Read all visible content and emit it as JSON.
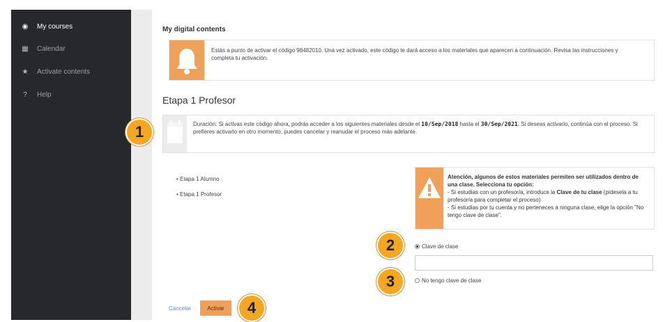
{
  "sidebar": {
    "items": [
      {
        "icon": "dashboard-icon",
        "glyph": "◉",
        "label": "My courses",
        "active": true
      },
      {
        "icon": "calendar-icon",
        "glyph": "▦",
        "label": "Calendar",
        "active": false
      },
      {
        "icon": "star-icon",
        "glyph": "★",
        "label": "Activate contents",
        "active": false
      },
      {
        "icon": "help-icon",
        "glyph": "?",
        "label": "Help",
        "active": false
      }
    ]
  },
  "main": {
    "title": "My digital contents",
    "activation_notice": "Estás a punto de activar el código 98482010. Una vez activado, este código te dará acceso a los materiales que aparecen a continuación. Revisa las instrucciones y completa tu activación.",
    "stage_title": "Etapa 1 Profesor",
    "duration": {
      "prefix": "Duración: Si activas este código ahora, podrás acceder a los siguientes materiales desde el ",
      "from": "10/Sep/2018",
      "mid": " hasta el ",
      "to": "30/Sep/2021",
      "suffix": ". Si deseas activarlo, continúa con el proceso. Si prefieres activarlo en otro momento, puedes cancelar y reanudar el proceso más adelante."
    },
    "materials": [
      "Etapa 1 Alumno",
      "Etapa 1 Profesor"
    ],
    "warning": {
      "heading": "Atención, algunos de estos materiales permiten ser utilizados dentro de una clase. Selecciona tu opción:",
      "line1_prefix": "- Si estudias con un profesor/a, introduce la ",
      "line1_bold": "Clave de tu clase",
      "line1_suffix": " (pídesela a tu profesor/a para completar el proceso)",
      "line2": "- Si estudias por tu cuenta y no perteneces a ninguna clase, elige la opción \"No tengo clave de clase\"."
    },
    "options": {
      "class_key_label": "Clave de clase",
      "no_key_label": "No tengo clave de clase",
      "selected": "class_key"
    },
    "class_key_value": "",
    "cancel_label": "Cancelar",
    "activate_label": "Activar"
  },
  "callouts": [
    "1",
    "2",
    "3",
    "4"
  ],
  "colors": {
    "sidebar_bg": "#26282b",
    "accent_orange": "#f0a058",
    "badge_orange": "#f5a623",
    "link_blue": "#5b8bd0"
  }
}
